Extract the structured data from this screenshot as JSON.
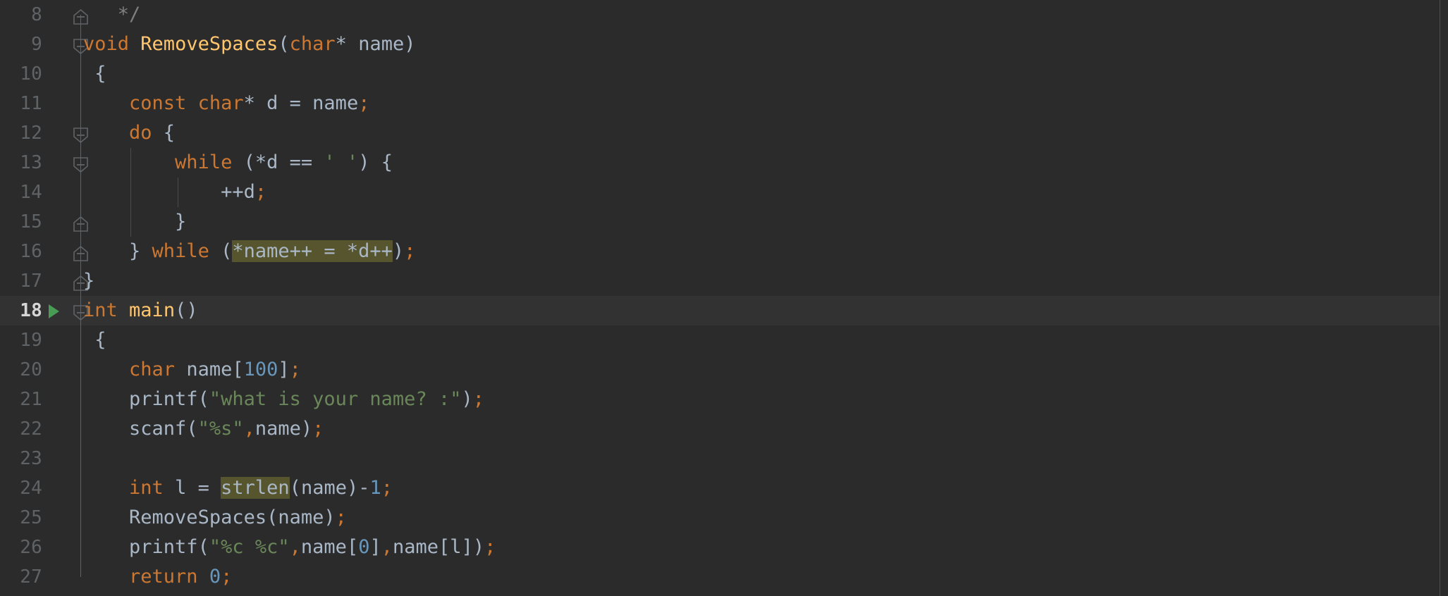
{
  "editor": {
    "theme_name": "darcula",
    "language": "c",
    "font_size_px": 27,
    "line_height_px": 42,
    "colors": {
      "background": "#2b2b2b",
      "current_line_background": "#323232",
      "line_number": "#606366",
      "current_line_number": "#d6d6d6",
      "keyword": "#cc7832",
      "function_declaration": "#ffc66d",
      "identifier": "#a9b7c6",
      "number": "#6897bb",
      "string": "#6a8759",
      "comment": "#808080",
      "semicolon": "#cc7832",
      "identifier_highlight_background": "#57552d",
      "fold_marker": "#606366",
      "indent_guide": "#4b4b4b",
      "run_marker": "#499c54",
      "scrollbar_separator": "#4e5052"
    },
    "first_visible_line": 8,
    "last_visible_line": 27,
    "current_line": 18,
    "run_gutter_lines": [
      18
    ],
    "highlighted_identifiers": [
      "*name++ = *d++",
      "strlen"
    ]
  },
  "lines": [
    {
      "number": "8",
      "current": false,
      "run_icon": false,
      "fold": "end",
      "fold_line_top": false,
      "fold_line_bottom": true,
      "indent_guides": [],
      "tokens": [
        {
          "t": "   ",
          "c": "pn"
        },
        {
          "t": "*/",
          "c": "cmt"
        }
      ]
    },
    {
      "number": "9",
      "current": false,
      "run_icon": false,
      "fold": "start",
      "fold_line_top": true,
      "fold_line_bottom": true,
      "indent_guides": [],
      "tokens": [
        {
          "t": "void",
          "c": "kw"
        },
        {
          "t": " ",
          "c": "pn"
        },
        {
          "t": "RemoveSpaces",
          "c": "fn"
        },
        {
          "t": "(",
          "c": "pn"
        },
        {
          "t": "char",
          "c": "kw"
        },
        {
          "t": "* ",
          "c": "pn"
        },
        {
          "t": "name",
          "c": "id"
        },
        {
          "t": ")",
          "c": "pn"
        }
      ]
    },
    {
      "number": "10",
      "current": false,
      "run_icon": false,
      "fold": "none",
      "fold_line_top": true,
      "fold_line_bottom": true,
      "indent_guides": [],
      "tokens": [
        {
          "t": " {",
          "c": "pn"
        }
      ]
    },
    {
      "number": "11",
      "current": false,
      "run_icon": false,
      "fold": "none",
      "fold_line_top": true,
      "fold_line_bottom": true,
      "indent_guides": [],
      "tokens": [
        {
          "t": "    ",
          "c": "pn"
        },
        {
          "t": "const",
          "c": "kw"
        },
        {
          "t": " ",
          "c": "pn"
        },
        {
          "t": "char",
          "c": "kw"
        },
        {
          "t": "* ",
          "c": "pn"
        },
        {
          "t": "d",
          "c": "id"
        },
        {
          "t": " = ",
          "c": "pn"
        },
        {
          "t": "name",
          "c": "id"
        },
        {
          "t": ";",
          "c": "semi"
        }
      ]
    },
    {
      "number": "12",
      "current": false,
      "run_icon": false,
      "fold": "start",
      "fold_line_top": true,
      "fold_line_bottom": true,
      "indent_guides": [],
      "tokens": [
        {
          "t": "    ",
          "c": "pn"
        },
        {
          "t": "do",
          "c": "kw"
        },
        {
          "t": " {",
          "c": "pn"
        }
      ]
    },
    {
      "number": "13",
      "current": false,
      "run_icon": false,
      "fold": "start",
      "fold_line_top": true,
      "fold_line_bottom": true,
      "indent_guides": [
        185
      ],
      "tokens": [
        {
          "t": "        ",
          "c": "pn"
        },
        {
          "t": "while",
          "c": "kw"
        },
        {
          "t": " (*",
          "c": "pn"
        },
        {
          "t": "d",
          "c": "id"
        },
        {
          "t": " == ",
          "c": "pn"
        },
        {
          "t": "' '",
          "c": "str"
        },
        {
          "t": ") {",
          "c": "pn"
        }
      ]
    },
    {
      "number": "14",
      "current": false,
      "run_icon": false,
      "fold": "none",
      "fold_line_top": true,
      "fold_line_bottom": true,
      "indent_guides": [
        185,
        252
      ],
      "tokens": [
        {
          "t": "            ++",
          "c": "pn"
        },
        {
          "t": "d",
          "c": "id"
        },
        {
          "t": ";",
          "c": "semi"
        }
      ]
    },
    {
      "number": "15",
      "current": false,
      "run_icon": false,
      "fold": "end",
      "fold_line_top": true,
      "fold_line_bottom": true,
      "indent_guides": [
        185
      ],
      "tokens": [
        {
          "t": "        }",
          "c": "pn"
        }
      ]
    },
    {
      "number": "16",
      "current": false,
      "run_icon": false,
      "fold": "end",
      "fold_line_top": true,
      "fold_line_bottom": true,
      "indent_guides": [],
      "tokens": [
        {
          "t": "    } ",
          "c": "pn"
        },
        {
          "t": "while",
          "c": "kw"
        },
        {
          "t": " (",
          "c": "pn"
        },
        {
          "t": "*name++ = *d++",
          "c": "hl"
        },
        {
          "t": ")",
          "c": "pn"
        },
        {
          "t": ";",
          "c": "semi"
        }
      ]
    },
    {
      "number": "17",
      "current": false,
      "run_icon": false,
      "fold": "end",
      "fold_line_top": true,
      "fold_line_bottom": true,
      "indent_guides": [],
      "tokens": [
        {
          "t": "}",
          "c": "pn"
        }
      ]
    },
    {
      "number": "18",
      "current": true,
      "run_icon": true,
      "fold": "start",
      "fold_line_top": true,
      "fold_line_bottom": true,
      "indent_guides": [],
      "tokens": [
        {
          "t": "int",
          "c": "kw"
        },
        {
          "t": " ",
          "c": "pn"
        },
        {
          "t": "main",
          "c": "fn"
        },
        {
          "t": "()",
          "c": "pn"
        }
      ]
    },
    {
      "number": "19",
      "current": false,
      "run_icon": false,
      "fold": "none",
      "fold_line_top": true,
      "fold_line_bottom": true,
      "indent_guides": [],
      "tokens": [
        {
          "t": " {",
          "c": "pn"
        }
      ]
    },
    {
      "number": "20",
      "current": false,
      "run_icon": false,
      "fold": "none",
      "fold_line_top": true,
      "fold_line_bottom": true,
      "indent_guides": [],
      "tokens": [
        {
          "t": "    ",
          "c": "pn"
        },
        {
          "t": "char",
          "c": "kw"
        },
        {
          "t": " ",
          "c": "pn"
        },
        {
          "t": "name",
          "c": "id"
        },
        {
          "t": "[",
          "c": "pn"
        },
        {
          "t": "100",
          "c": "num"
        },
        {
          "t": "]",
          "c": "pn"
        },
        {
          "t": ";",
          "c": "semi"
        }
      ]
    },
    {
      "number": "21",
      "current": false,
      "run_icon": false,
      "fold": "none",
      "fold_line_top": true,
      "fold_line_bottom": true,
      "indent_guides": [],
      "tokens": [
        {
          "t": "    ",
          "c": "pn"
        },
        {
          "t": "printf",
          "c": "id"
        },
        {
          "t": "(",
          "c": "pn"
        },
        {
          "t": "\"what is your name? :\"",
          "c": "str"
        },
        {
          "t": ")",
          "c": "pn"
        },
        {
          "t": ";",
          "c": "semi"
        }
      ]
    },
    {
      "number": "22",
      "current": false,
      "run_icon": false,
      "fold": "none",
      "fold_line_top": true,
      "fold_line_bottom": true,
      "indent_guides": [],
      "tokens": [
        {
          "t": "    ",
          "c": "pn"
        },
        {
          "t": "scanf",
          "c": "id"
        },
        {
          "t": "(",
          "c": "pn"
        },
        {
          "t": "\"%s\"",
          "c": "str"
        },
        {
          "t": ",",
          "c": "semi"
        },
        {
          "t": "name",
          "c": "id"
        },
        {
          "t": ")",
          "c": "pn"
        },
        {
          "t": ";",
          "c": "semi"
        }
      ]
    },
    {
      "number": "23",
      "current": false,
      "run_icon": false,
      "fold": "none",
      "fold_line_top": true,
      "fold_line_bottom": true,
      "indent_guides": [],
      "tokens": []
    },
    {
      "number": "24",
      "current": false,
      "run_icon": false,
      "fold": "none",
      "fold_line_top": true,
      "fold_line_bottom": true,
      "indent_guides": [],
      "tokens": [
        {
          "t": "    ",
          "c": "pn"
        },
        {
          "t": "int",
          "c": "kw"
        },
        {
          "t": " ",
          "c": "pn"
        },
        {
          "t": "l",
          "c": "id"
        },
        {
          "t": " = ",
          "c": "pn"
        },
        {
          "t": "strlen",
          "c": "hl"
        },
        {
          "t": "(",
          "c": "pn"
        },
        {
          "t": "name",
          "c": "id"
        },
        {
          "t": ")-",
          "c": "pn"
        },
        {
          "t": "1",
          "c": "num"
        },
        {
          "t": ";",
          "c": "semi"
        }
      ]
    },
    {
      "number": "25",
      "current": false,
      "run_icon": false,
      "fold": "none",
      "fold_line_top": true,
      "fold_line_bottom": true,
      "indent_guides": [],
      "tokens": [
        {
          "t": "    ",
          "c": "pn"
        },
        {
          "t": "RemoveSpaces",
          "c": "id"
        },
        {
          "t": "(",
          "c": "pn"
        },
        {
          "t": "name",
          "c": "id"
        },
        {
          "t": ")",
          "c": "pn"
        },
        {
          "t": ";",
          "c": "semi"
        }
      ]
    },
    {
      "number": "26",
      "current": false,
      "run_icon": false,
      "fold": "none",
      "fold_line_top": true,
      "fold_line_bottom": true,
      "indent_guides": [],
      "tokens": [
        {
          "t": "    ",
          "c": "pn"
        },
        {
          "t": "printf",
          "c": "id"
        },
        {
          "t": "(",
          "c": "pn"
        },
        {
          "t": "\"%c %c\"",
          "c": "str"
        },
        {
          "t": ",",
          "c": "semi"
        },
        {
          "t": "name",
          "c": "id"
        },
        {
          "t": "[",
          "c": "pn"
        },
        {
          "t": "0",
          "c": "num"
        },
        {
          "t": "]",
          "c": "pn"
        },
        {
          "t": ",",
          "c": "semi"
        },
        {
          "t": "name",
          "c": "id"
        },
        {
          "t": "[",
          "c": "pn"
        },
        {
          "t": "l",
          "c": "id"
        },
        {
          "t": "]",
          "c": "pn"
        },
        {
          "t": ")",
          "c": "pn"
        },
        {
          "t": ";",
          "c": "semi"
        }
      ]
    },
    {
      "number": "27",
      "current": false,
      "run_icon": false,
      "fold": "none",
      "fold_line_top": true,
      "fold_line_bottom": false,
      "indent_guides": [],
      "tokens": [
        {
          "t": "    ",
          "c": "pn"
        },
        {
          "t": "return",
          "c": "kw"
        },
        {
          "t": " ",
          "c": "pn"
        },
        {
          "t": "0",
          "c": "num"
        },
        {
          "t": ";",
          "c": "semi"
        }
      ]
    }
  ]
}
